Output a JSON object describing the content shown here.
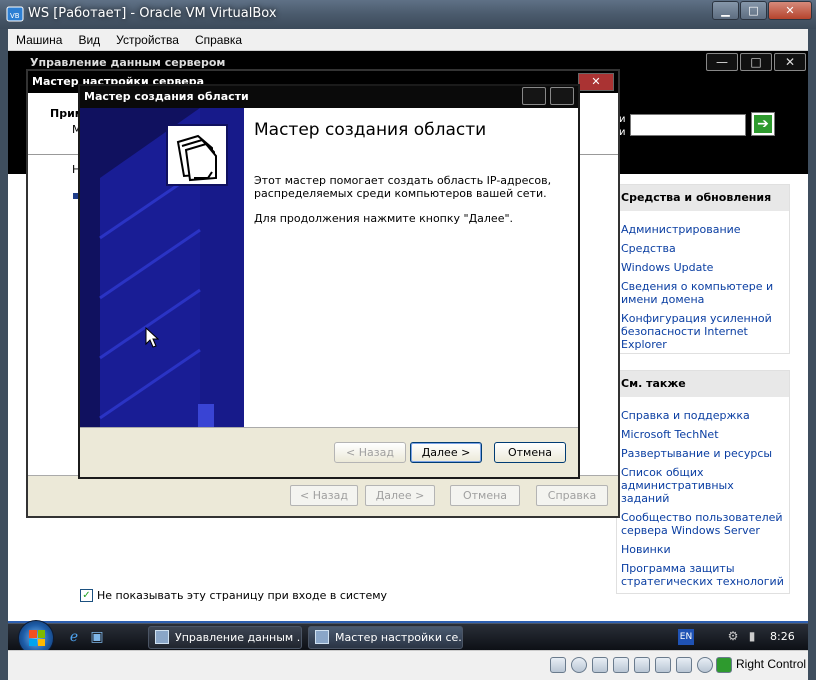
{
  "host": {
    "title": "WS [Работает] - Oracle VM VirtualBox",
    "controls": {
      "minimize": "▁",
      "maximize": "□",
      "close": "✕"
    },
    "menu": [
      "Машина",
      "Вид",
      "Устройства",
      "Справка"
    ],
    "status_right": "Right Control"
  },
  "guest_mgmt": {
    "title": "Управление данным сервером",
    "controls": {
      "minimize": "—",
      "maximize": "□",
      "close": "✕"
    },
    "right_pane": {
      "tools_header": "Средства и обновления",
      "tools_links": [
        "Администрирование",
        "Средства",
        "Windows Update",
        "Сведения о компьютере и имени домена",
        "Конфигурация усиленной безопасности Internet Explorer"
      ],
      "see_also_header": "См. также",
      "see_also_links": [
        "Справка и поддержка",
        "Microsoft TechNet",
        "Развертывание и ресурсы",
        "Список общих административных заданий",
        "Сообщество пользователей сервера Windows Server",
        "Новинки",
        "Программа защиты стратегических технологий"
      ],
      "search_left_letters": "и",
      "search_left_letters2": "и"
    },
    "show_page_checkbox": {
      "checked": true,
      "label": "Не показывать эту страницу при входе в систему"
    }
  },
  "config_wizard": {
    "title": "Мастер настройки сервера",
    "header_text": "Прим",
    "header_sub": "М",
    "body_text": "Н",
    "buttons": {
      "back": "< Назад",
      "next": "Далее >",
      "cancel": "Отмена",
      "help": "Справка"
    }
  },
  "scope_wizard": {
    "title": "Мастер создания области",
    "heading": "Мастер создания области",
    "para1": "Этот мастер помогает создать область IP-адресов, распределяемых среди компьютеров вашей сети.",
    "para2": "Для продолжения нажмите кнопку \"Далее\".",
    "buttons": {
      "back": "< Назад",
      "next": "Далее >",
      "cancel": "Отмена"
    }
  },
  "taskbar": {
    "items": [
      {
        "label": "Управление данным ...",
        "active": false
      },
      {
        "label": "Мастер настройки се...",
        "active": true
      }
    ],
    "lang": "EN",
    "clock": "8:26"
  }
}
